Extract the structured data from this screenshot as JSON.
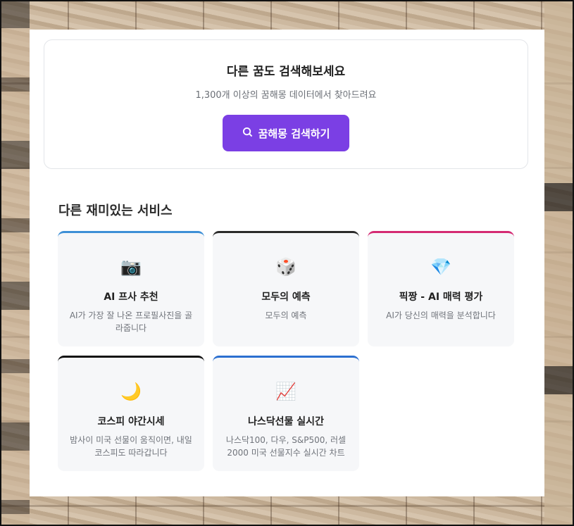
{
  "search": {
    "title": "다른 꿈도 검색해보세요",
    "subtitle": "1,300개 이상의 꿈해몽 데이터에서 찾아드려요",
    "button_label": "꿈해몽 검색하기",
    "button_icon": "search-icon",
    "accent_color": "#7b3fe4"
  },
  "services": {
    "title": "다른 재미있는 서비스",
    "items": [
      {
        "emoji": "📷",
        "icon": "camera-icon",
        "title": "AI 프사 추천",
        "desc": "AI가 가장 잘 나온 프로필사진을 골라줍니다",
        "accent": "#3d8fd6"
      },
      {
        "emoji": "🎲",
        "icon": "dice-icon",
        "title": "모두의 예측",
        "desc": "모두의 예측",
        "accent": "#2a2a2a"
      },
      {
        "emoji": "💎",
        "icon": "gem-icon",
        "title": "픽짱 - AI 매력 평가",
        "desc": "AI가 당신의 매력을 분석합니다",
        "accent": "#d42a73"
      },
      {
        "emoji": "🌙",
        "icon": "moon-icon",
        "title": "코스피 야간시세",
        "desc": "밤사이 미국 선물이 움직이면, 내일 코스피도 따라갑니다",
        "accent": "#111111"
      },
      {
        "emoji": "📈",
        "icon": "chart-up-icon",
        "title": "나스닥선물 실시간",
        "desc": "나스닥100, 다우, S&P500, 러셀 2000 미국 선물지수 실시간 차트",
        "accent": "#2b6fd0"
      }
    ]
  }
}
